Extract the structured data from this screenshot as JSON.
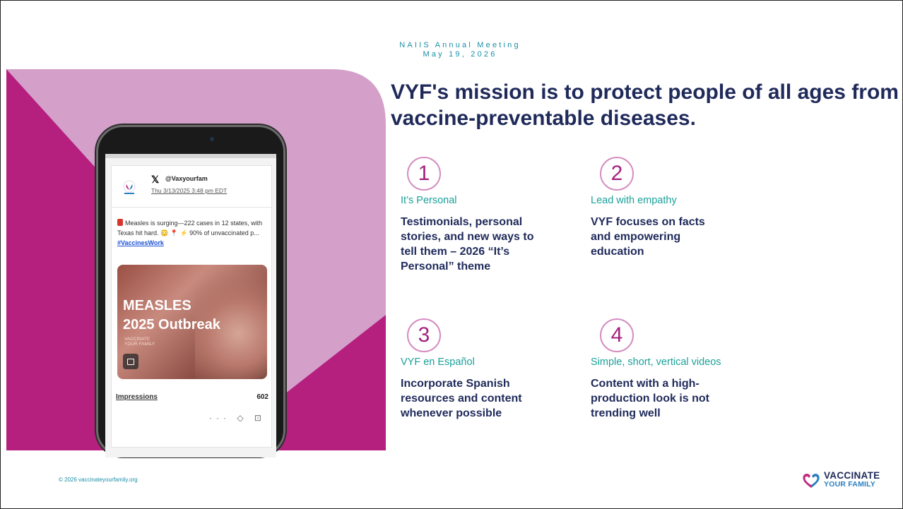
{
  "meeting": {
    "line1": "NAIIS Annual Meeting",
    "line2": "May 19, 2026"
  },
  "mission": "VYF's mission is to protect people of all ages from vaccine-preventable diseases.",
  "items": [
    {
      "number": "1",
      "title": "It’s Personal",
      "body": "Testimonials, personal stories, and new ways to tell them – 2026 “It’s Personal” theme"
    },
    {
      "number": "2",
      "title": "Lead with empathy",
      "body": "VYF focuses on facts and empowering education"
    },
    {
      "number": "3",
      "title": "VYF en Español",
      "body": "Incorporate Spanish resources and content whenever possible"
    },
    {
      "number": "4",
      "title": "Simple, short, vertical videos",
      "body": "Content with a high-production look is not trending well"
    }
  ],
  "phone": {
    "handle": "@Vaxyourfam",
    "date": "Thu 3/13/2025 3:48 pm EDT",
    "post_text": "Measles is surging—222 cases in 12 states, with Texas hit hard. 😳 📍 ⚡ 90% of unvaccinated p...",
    "hashtag": "#VaccinesWork",
    "media_line1": "MEASLES",
    "media_line2": "2025 Outbreak",
    "media_logo_line1": "VACCINATE",
    "media_logo_line2": "YOUR FAMILY",
    "impressions_label": "Impressions",
    "impressions_value": "602",
    "actions": "··· ◇ ⊡"
  },
  "footer": {
    "copyright": "© 2026 vaccinateyourfamily.org",
    "logo_line1": "VACCINATE",
    "logo_line2": "YOUR FAMILY"
  },
  "colors": {
    "navy": "#1f2a5a",
    "teal": "#1aa19a",
    "magenta": "#b5207f",
    "lilac": "#d4a0ca",
    "accent_blue": "#1a8fa8"
  },
  "icons": [
    "x-logo-icon",
    "vyf-avatar-icon",
    "alert-icon",
    "video-icon",
    "more-icon",
    "tag-icon",
    "reply-icon",
    "vyf-heart-logo-icon"
  ]
}
